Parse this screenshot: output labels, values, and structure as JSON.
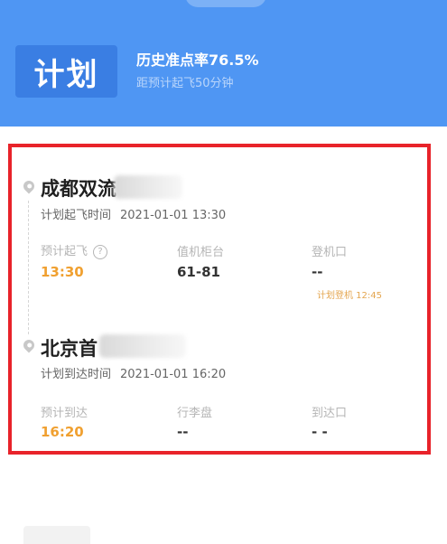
{
  "header": {
    "status": "计划",
    "ontime_rate": "历史准点率76.5%",
    "countdown": "距预计起飞50分钟",
    "bg_color": "#4f96f3"
  },
  "departure": {
    "airport": "成都双流",
    "plan_label": "计划起飞时间",
    "plan_time": "2021-01-01 13:30",
    "fields": [
      {
        "label": "预计起飞",
        "value": "13:30"
      },
      {
        "label": "值机柜台",
        "value": "61-81"
      },
      {
        "label": "登机口",
        "value": "--"
      }
    ],
    "boarding_note": "计划登机 12:45"
  },
  "arrival": {
    "airport": "北京首",
    "plan_label": "计划到达时间",
    "plan_time": "2021-01-01 16:20",
    "fields": [
      {
        "label": "预计到达",
        "value": "16:20"
      },
      {
        "label": "行李盘",
        "value": "--"
      },
      {
        "label": "到达口",
        "value": "- -"
      }
    ]
  },
  "colors": {
    "highlight_border": "#e8232a",
    "time_accent": "#f0a030"
  },
  "icons": [
    "location-pin-icon",
    "question-circle-icon"
  ]
}
